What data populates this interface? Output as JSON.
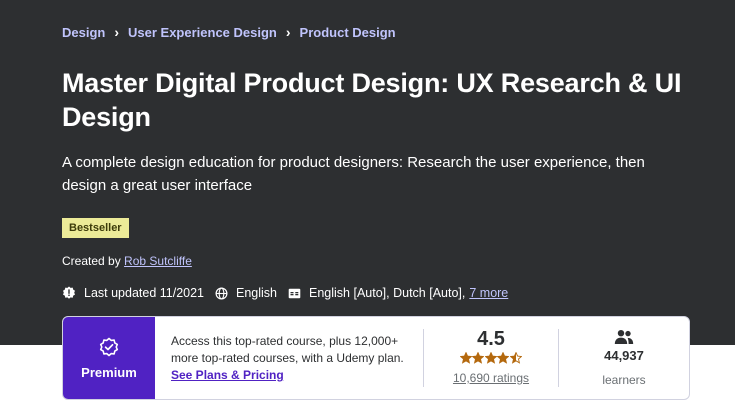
{
  "breadcrumb": {
    "items": [
      "Design",
      "User Experience Design",
      "Product Design"
    ]
  },
  "course": {
    "title": "Master Digital Product Design: UX Research & UI Design",
    "subtitle": "A complete design education for product designers: Research the user experience, then design a great user interface",
    "badge": "Bestseller",
    "created_by_label": "Created by",
    "instructor": "Rob Sutcliffe"
  },
  "meta": {
    "last_updated": "Last updated 11/2021",
    "language": "English",
    "captions": "English [Auto], Dutch [Auto],",
    "more_link": "7 more"
  },
  "premium_card": {
    "label": "Premium",
    "access_text": "Access this top-rated course, plus 12,000+ more top-rated courses, with a Udemy plan.",
    "plans_link": "See Plans & Pricing",
    "rating_value": "4.5",
    "rating_number": 4.5,
    "ratings_count": "10,690 ratings",
    "learners_count": "44,937",
    "learners_label": "learners"
  },
  "colors": {
    "hero_bg": "#2d2f31",
    "link": "#c0c4fc",
    "badge_bg": "#eceb98",
    "premium_bg": "#5022c3",
    "star": "#b4690e"
  },
  "icons": {
    "breadcrumb_separator": "chevron-right-icon",
    "last_updated": "alert-badge-icon",
    "language": "globe-icon",
    "captions": "closed-captions-icon",
    "premium": "premium-badge-icon",
    "learners": "users-icon"
  }
}
